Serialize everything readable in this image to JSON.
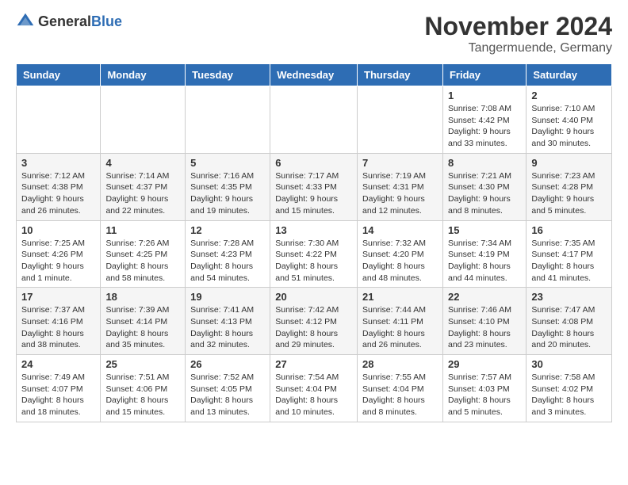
{
  "header": {
    "logo_general": "General",
    "logo_blue": "Blue",
    "month_title": "November 2024",
    "location": "Tangermuende, Germany"
  },
  "weekdays": [
    "Sunday",
    "Monday",
    "Tuesday",
    "Wednesday",
    "Thursday",
    "Friday",
    "Saturday"
  ],
  "weeks": [
    [
      {
        "day": "",
        "info": ""
      },
      {
        "day": "",
        "info": ""
      },
      {
        "day": "",
        "info": ""
      },
      {
        "day": "",
        "info": ""
      },
      {
        "day": "",
        "info": ""
      },
      {
        "day": "1",
        "info": "Sunrise: 7:08 AM\nSunset: 4:42 PM\nDaylight: 9 hours\nand 33 minutes."
      },
      {
        "day": "2",
        "info": "Sunrise: 7:10 AM\nSunset: 4:40 PM\nDaylight: 9 hours\nand 30 minutes."
      }
    ],
    [
      {
        "day": "3",
        "info": "Sunrise: 7:12 AM\nSunset: 4:38 PM\nDaylight: 9 hours\nand 26 minutes."
      },
      {
        "day": "4",
        "info": "Sunrise: 7:14 AM\nSunset: 4:37 PM\nDaylight: 9 hours\nand 22 minutes."
      },
      {
        "day": "5",
        "info": "Sunrise: 7:16 AM\nSunset: 4:35 PM\nDaylight: 9 hours\nand 19 minutes."
      },
      {
        "day": "6",
        "info": "Sunrise: 7:17 AM\nSunset: 4:33 PM\nDaylight: 9 hours\nand 15 minutes."
      },
      {
        "day": "7",
        "info": "Sunrise: 7:19 AM\nSunset: 4:31 PM\nDaylight: 9 hours\nand 12 minutes."
      },
      {
        "day": "8",
        "info": "Sunrise: 7:21 AM\nSunset: 4:30 PM\nDaylight: 9 hours\nand 8 minutes."
      },
      {
        "day": "9",
        "info": "Sunrise: 7:23 AM\nSunset: 4:28 PM\nDaylight: 9 hours\nand 5 minutes."
      }
    ],
    [
      {
        "day": "10",
        "info": "Sunrise: 7:25 AM\nSunset: 4:26 PM\nDaylight: 9 hours\nand 1 minute."
      },
      {
        "day": "11",
        "info": "Sunrise: 7:26 AM\nSunset: 4:25 PM\nDaylight: 8 hours\nand 58 minutes."
      },
      {
        "day": "12",
        "info": "Sunrise: 7:28 AM\nSunset: 4:23 PM\nDaylight: 8 hours\nand 54 minutes."
      },
      {
        "day": "13",
        "info": "Sunrise: 7:30 AM\nSunset: 4:22 PM\nDaylight: 8 hours\nand 51 minutes."
      },
      {
        "day": "14",
        "info": "Sunrise: 7:32 AM\nSunset: 4:20 PM\nDaylight: 8 hours\nand 48 minutes."
      },
      {
        "day": "15",
        "info": "Sunrise: 7:34 AM\nSunset: 4:19 PM\nDaylight: 8 hours\nand 44 minutes."
      },
      {
        "day": "16",
        "info": "Sunrise: 7:35 AM\nSunset: 4:17 PM\nDaylight: 8 hours\nand 41 minutes."
      }
    ],
    [
      {
        "day": "17",
        "info": "Sunrise: 7:37 AM\nSunset: 4:16 PM\nDaylight: 8 hours\nand 38 minutes."
      },
      {
        "day": "18",
        "info": "Sunrise: 7:39 AM\nSunset: 4:14 PM\nDaylight: 8 hours\nand 35 minutes."
      },
      {
        "day": "19",
        "info": "Sunrise: 7:41 AM\nSunset: 4:13 PM\nDaylight: 8 hours\nand 32 minutes."
      },
      {
        "day": "20",
        "info": "Sunrise: 7:42 AM\nSunset: 4:12 PM\nDaylight: 8 hours\nand 29 minutes."
      },
      {
        "day": "21",
        "info": "Sunrise: 7:44 AM\nSunset: 4:11 PM\nDaylight: 8 hours\nand 26 minutes."
      },
      {
        "day": "22",
        "info": "Sunrise: 7:46 AM\nSunset: 4:10 PM\nDaylight: 8 hours\nand 23 minutes."
      },
      {
        "day": "23",
        "info": "Sunrise: 7:47 AM\nSunset: 4:08 PM\nDaylight: 8 hours\nand 20 minutes."
      }
    ],
    [
      {
        "day": "24",
        "info": "Sunrise: 7:49 AM\nSunset: 4:07 PM\nDaylight: 8 hours\nand 18 minutes."
      },
      {
        "day": "25",
        "info": "Sunrise: 7:51 AM\nSunset: 4:06 PM\nDaylight: 8 hours\nand 15 minutes."
      },
      {
        "day": "26",
        "info": "Sunrise: 7:52 AM\nSunset: 4:05 PM\nDaylight: 8 hours\nand 13 minutes."
      },
      {
        "day": "27",
        "info": "Sunrise: 7:54 AM\nSunset: 4:04 PM\nDaylight: 8 hours\nand 10 minutes."
      },
      {
        "day": "28",
        "info": "Sunrise: 7:55 AM\nSunset: 4:04 PM\nDaylight: 8 hours\nand 8 minutes."
      },
      {
        "day": "29",
        "info": "Sunrise: 7:57 AM\nSunset: 4:03 PM\nDaylight: 8 hours\nand 5 minutes."
      },
      {
        "day": "30",
        "info": "Sunrise: 7:58 AM\nSunset: 4:02 PM\nDaylight: 8 hours\nand 3 minutes."
      }
    ]
  ]
}
